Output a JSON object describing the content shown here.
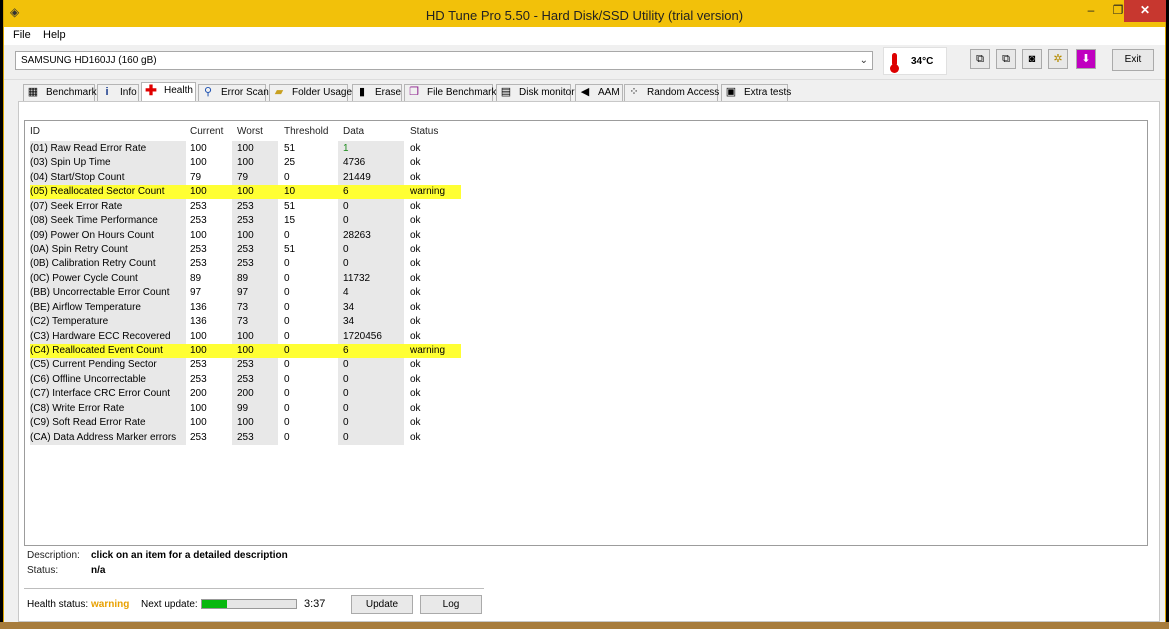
{
  "window": {
    "title": "HD Tune Pro 5.50 - Hard Disk/SSD Utility (trial version)"
  },
  "window_buttons": {
    "minimize": "–",
    "maximize": "❐",
    "close": "✕"
  },
  "menu": {
    "file": "File",
    "help": "Help"
  },
  "toolbar": {
    "drive": "SAMSUNG HD160JJ (160 gB)",
    "temperature": "34°C",
    "exit_label": "Exit"
  },
  "tabs": [
    {
      "label": "Benchmark",
      "icon": "benchmark-icon"
    },
    {
      "label": "Info",
      "icon": "info-icon"
    },
    {
      "label": "Health",
      "icon": "health-cross-icon"
    },
    {
      "label": "Error Scan",
      "icon": "magnifier-icon"
    },
    {
      "label": "Folder Usage",
      "icon": "folder-icon"
    },
    {
      "label": "Erase",
      "icon": "trash-icon"
    },
    {
      "label": "File Benchmark",
      "icon": "file-benchmark-icon"
    },
    {
      "label": "Disk monitor",
      "icon": "disk-monitor-icon"
    },
    {
      "label": "AAM",
      "icon": "speaker-icon"
    },
    {
      "label": "Random Access",
      "icon": "random-access-icon"
    },
    {
      "label": "Extra tests",
      "icon": "extra-tests-icon"
    }
  ],
  "columns": [
    "ID",
    "Current",
    "Worst",
    "Threshold",
    "Data",
    "Status"
  ],
  "rows": [
    [
      "(01) Raw Read Error Rate",
      "100",
      "100",
      "51",
      "1",
      "ok"
    ],
    [
      "(03) Spin Up Time",
      "100",
      "100",
      "25",
      "4736",
      "ok"
    ],
    [
      "(04) Start/Stop Count",
      "79",
      "79",
      "0",
      "21449",
      "ok"
    ],
    [
      "(05) Reallocated Sector Count",
      "100",
      "100",
      "10",
      "6",
      "warning"
    ],
    [
      "(07) Seek Error Rate",
      "253",
      "253",
      "51",
      "0",
      "ok"
    ],
    [
      "(08) Seek Time Performance",
      "253",
      "253",
      "15",
      "0",
      "ok"
    ],
    [
      "(09) Power On Hours Count",
      "100",
      "100",
      "0",
      "28263",
      "ok"
    ],
    [
      "(0A) Spin Retry Count",
      "253",
      "253",
      "51",
      "0",
      "ok"
    ],
    [
      "(0B) Calibration Retry Count",
      "253",
      "253",
      "0",
      "0",
      "ok"
    ],
    [
      "(0C) Power Cycle Count",
      "89",
      "89",
      "0",
      "11732",
      "ok"
    ],
    [
      "(BB) Uncorrectable Error Count",
      "97",
      "97",
      "0",
      "4",
      "ok"
    ],
    [
      "(BE) Airflow Temperature",
      "136",
      "73",
      "0",
      "34",
      "ok"
    ],
    [
      "(C2) Temperature",
      "136",
      "73",
      "0",
      "34",
      "ok"
    ],
    [
      "(C3) Hardware ECC Recovered",
      "100",
      "100",
      "0",
      "1720456",
      "ok"
    ],
    [
      "(C4) Reallocated Event Count",
      "100",
      "100",
      "0",
      "6",
      "warning"
    ],
    [
      "(C5) Current Pending Sector",
      "253",
      "253",
      "0",
      "0",
      "ok"
    ],
    [
      "(C6) Offline Uncorrectable",
      "253",
      "253",
      "0",
      "0",
      "ok"
    ],
    [
      "(C7) Interface CRC Error Count",
      "200",
      "200",
      "0",
      "0",
      "ok"
    ],
    [
      "(C8) Write Error Rate",
      "100",
      "99",
      "0",
      "0",
      "ok"
    ],
    [
      "(C9) Soft Read Error Rate",
      "100",
      "100",
      "0",
      "0",
      "ok"
    ],
    [
      "(CA) Data Address Marker errors",
      "253",
      "253",
      "0",
      "0",
      "ok"
    ]
  ],
  "details": {
    "description_label": "Description:",
    "description_value": "click on an item for a detailed description",
    "status_label": "Status:",
    "status_value": "n/a"
  },
  "footer": {
    "health_status_label": "Health status:",
    "health_status_value": "warning",
    "next_update_label": "Next update:",
    "next_update_progress": 0.27,
    "next_update_time": "3:37",
    "update_button": "Update",
    "log_button": "Log"
  },
  "colors": {
    "warning_row": "#ffff33",
    "warning_text": "#e8a000",
    "progress": "#07b80f",
    "titlebar": "#f2c10a"
  }
}
